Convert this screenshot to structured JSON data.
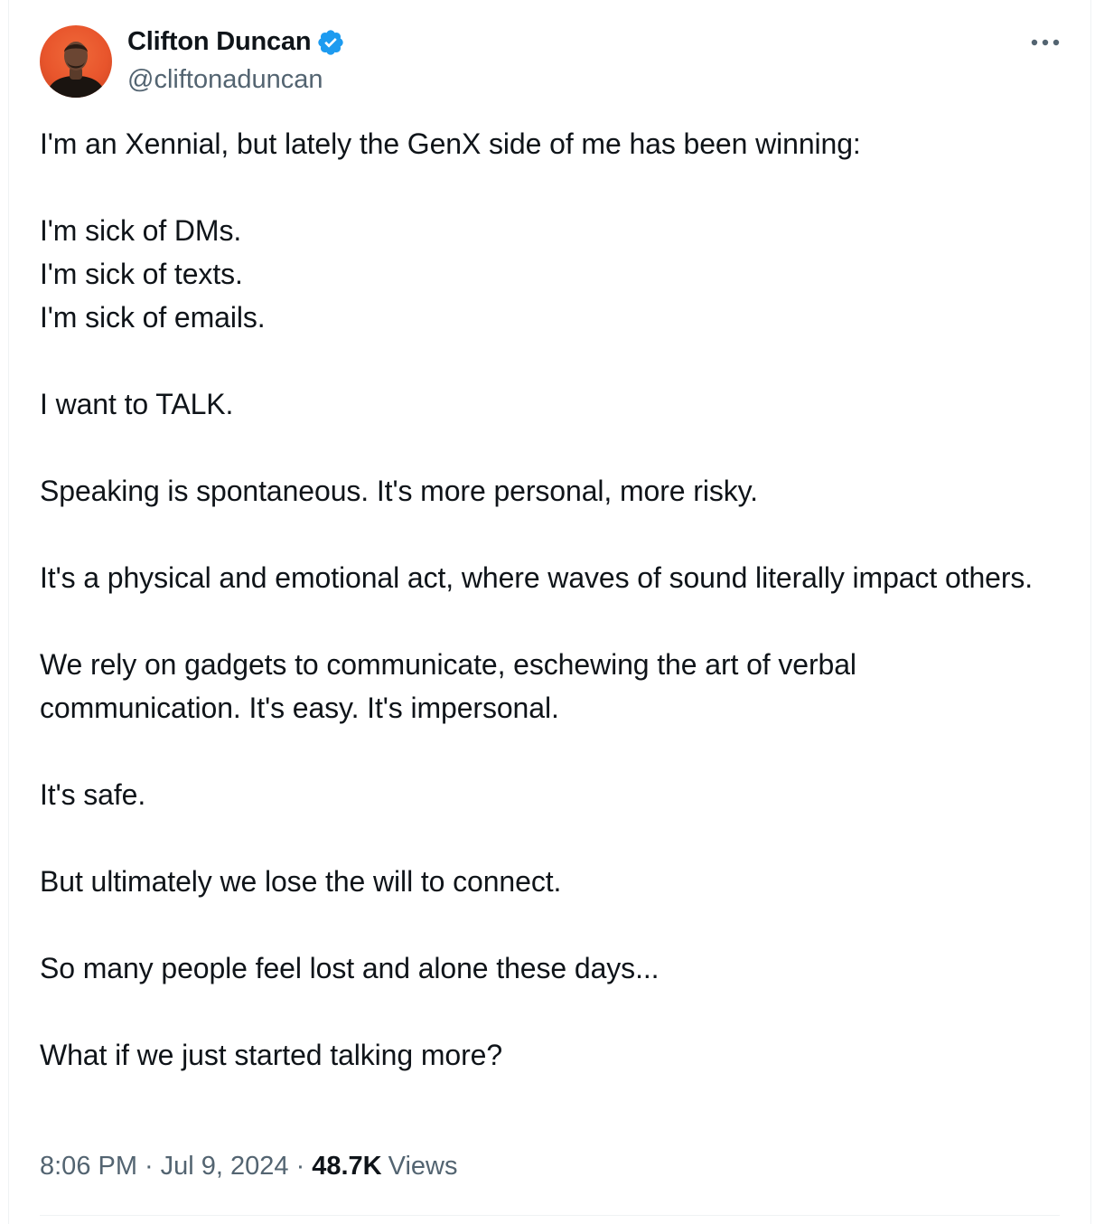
{
  "author": {
    "display_name": "Clifton Duncan",
    "handle": "@cliftonaduncan",
    "verified": true,
    "verified_color": "#1d9bf0",
    "avatar_bg": "#e8552c"
  },
  "tweet": {
    "paragraphs": [
      "I'm an Xennial, but lately the GenX side of me has been winning:",
      "I'm sick of DMs.\nI'm sick of texts.\nI'm sick of emails.",
      "I want to TALK.",
      "Speaking is spontaneous. It's more personal, more risky.",
      "It's a physical and emotional act, where waves of sound literally impact others.",
      "We rely on gadgets to communicate, eschewing the art of verbal communication. It's easy. It's impersonal.",
      "It's safe.",
      "But ultimately we lose the will to connect.",
      "So many people feel lost and alone these days...",
      "What if we just started talking more?"
    ],
    "time": "8:06 PM",
    "separator": "·",
    "date": "Jul 9, 2024",
    "views_count": "48.7K",
    "views_label": "Views"
  },
  "icons": {
    "more": "more-horizontal-icon",
    "verified": "verified-badge-icon"
  }
}
